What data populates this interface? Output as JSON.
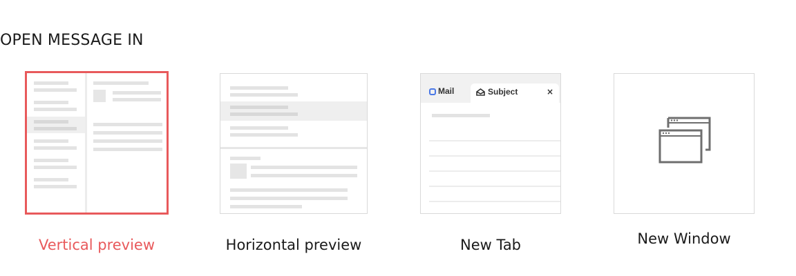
{
  "section": {
    "title": "OPEN MESSAGE IN"
  },
  "options": [
    {
      "label": "Vertical preview",
      "selected": true
    },
    {
      "label": "Horizontal preview",
      "selected": false
    },
    {
      "label": "New Tab",
      "selected": false
    },
    {
      "label": "New Window",
      "selected": false
    }
  ],
  "tab_preview": {
    "tab1": "Mail",
    "tab2": "Subject",
    "close": "×"
  },
  "colors": {
    "accent": "#e8595b",
    "border": "#d9d9d9",
    "line": "#e3e3e3"
  }
}
